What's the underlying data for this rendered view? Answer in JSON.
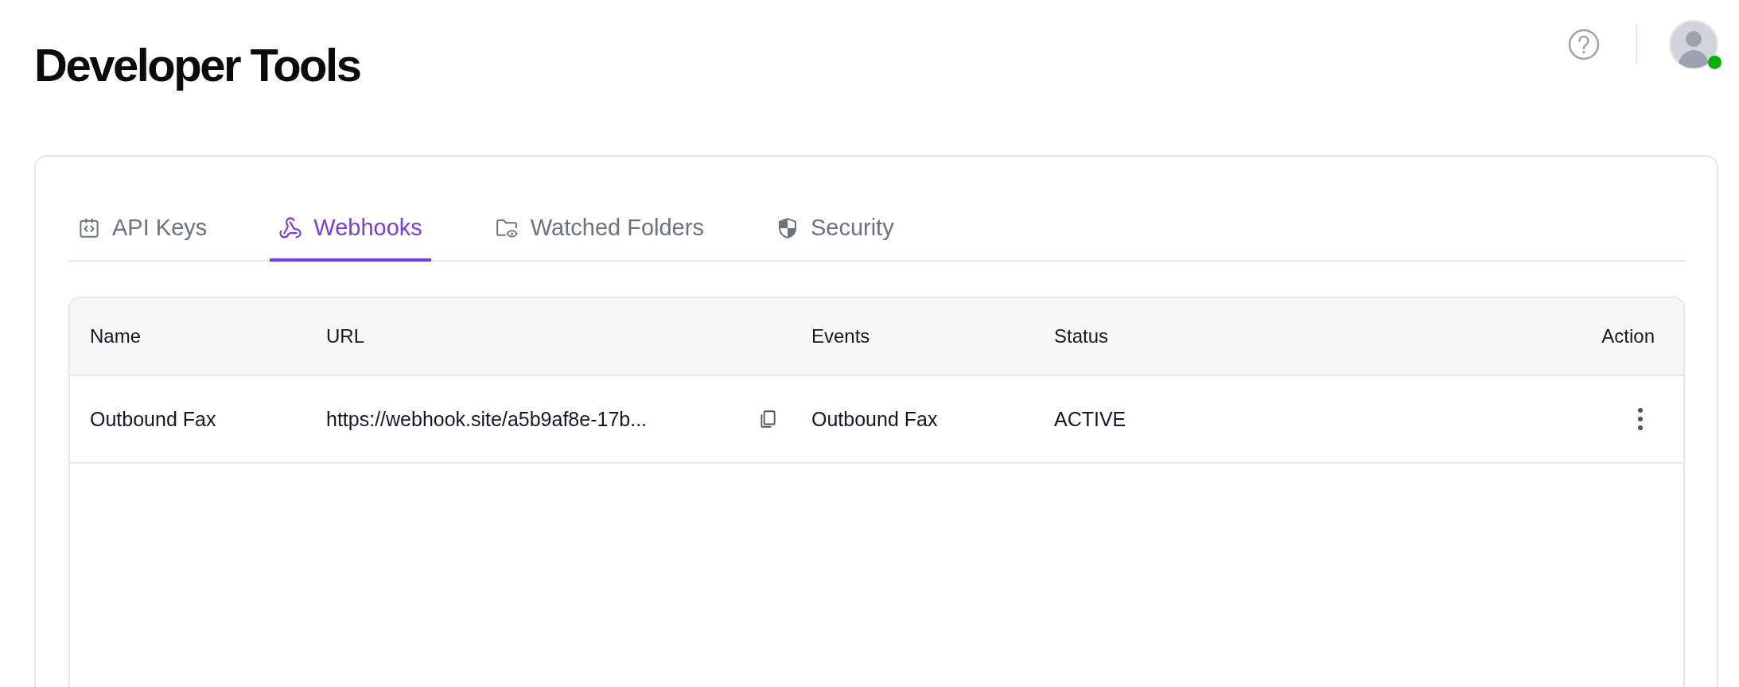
{
  "page": {
    "title": "Developer Tools"
  },
  "header": {
    "avatar": {
      "online": true
    }
  },
  "tabs": [
    {
      "label": "API Keys",
      "kind": "code",
      "selected": false
    },
    {
      "label": "Webhooks",
      "kind": "webhook",
      "selected": true
    },
    {
      "label": "Watched Folders",
      "kind": "folder",
      "selected": false
    },
    {
      "label": "Security",
      "kind": "shield",
      "selected": false
    }
  ],
  "table": {
    "columns": [
      "Name",
      "URL",
      "Events",
      "Status",
      "Action"
    ],
    "rows": [
      {
        "name": "Outbound Fax",
        "url": "https://webhook.site/a5b9af8e-17b...",
        "events": "Outbound Fax",
        "status": "ACTIVE"
      }
    ]
  }
}
